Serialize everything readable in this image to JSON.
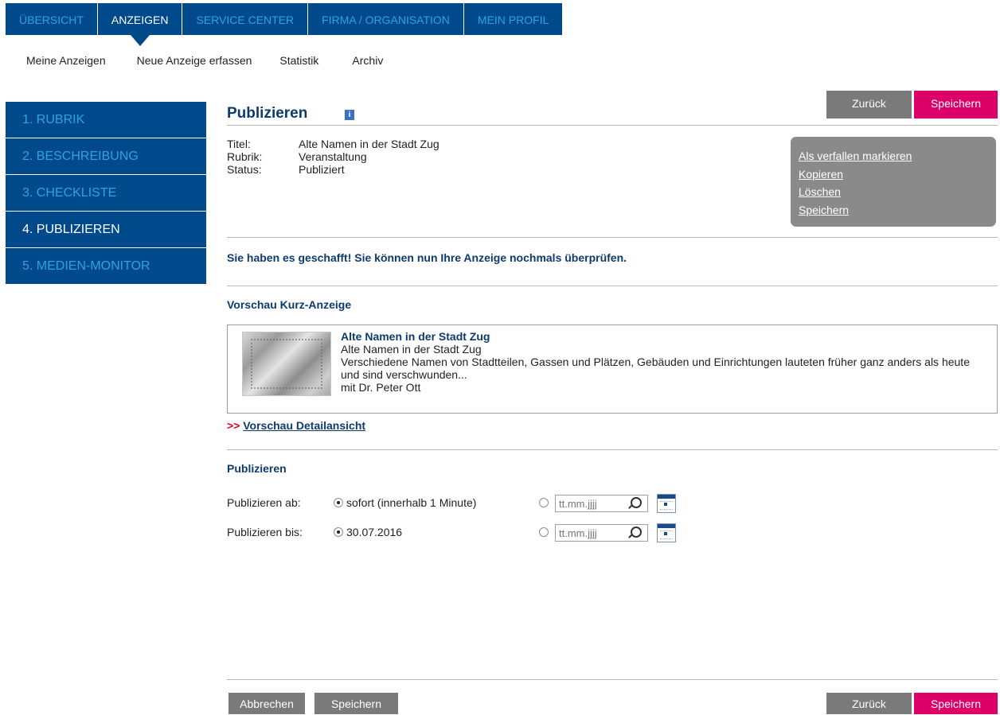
{
  "topnav": {
    "tabs": [
      {
        "label": "ÜBERSICHT"
      },
      {
        "label": "ANZEIGEN"
      },
      {
        "label": "SERVICE CENTER"
      },
      {
        "label": "FIRMA / ORGANISATION"
      },
      {
        "label": "MEIN PROFIL"
      }
    ]
  },
  "subnav": {
    "items": [
      {
        "label": "Meine Anzeigen"
      },
      {
        "label": "Neue Anzeige erfassen"
      },
      {
        "label": "Statistik"
      },
      {
        "label": "Archiv"
      }
    ]
  },
  "sidebar": {
    "steps": [
      {
        "label": "1. RUBRIK"
      },
      {
        "label": "2. BESCHREIBUNG"
      },
      {
        "label": "3. CHECKLISTE"
      },
      {
        "label": "4. PUBLIZIEREN"
      },
      {
        "label": "5. MEDIEN-MONITOR"
      }
    ]
  },
  "page": {
    "title": "Publizieren",
    "info_icon": "i",
    "back_label": "Zurück",
    "save_label": "Speichern"
  },
  "meta": {
    "titel_key": "Titel:",
    "titel_val": "Alte Namen in der Stadt Zug",
    "rubrik_key": "Rubrik:",
    "rubrik_val": "Veranstaltung",
    "status_key": "Status:",
    "status_val": "Publiziert"
  },
  "actions": {
    "expire": "Als verfallen markieren",
    "copy": "Kopieren",
    "delete": "Löschen",
    "save": "Speichern"
  },
  "success_message": "Sie haben es geschafft! Sie können nun Ihre Anzeige nochmals überprüfen.",
  "preview": {
    "heading": "Vorschau Kurz-Anzeige",
    "title": "Alte Namen in der Stadt Zug",
    "subtitle": "Alte Namen in der Stadt Zug",
    "description": "Verschiedene Namen von Stadtteilen, Gassen und Plätzen, Gebäuden und Einrichtungen lauteten früher ganz anders als heute und sind verschwunden...",
    "speaker": "mit Dr. Peter Ott",
    "detail_arrow": ">>",
    "detail_link": "Vorschau Detailansicht"
  },
  "publish": {
    "heading": "Publizieren",
    "from_label": "Publizieren ab:",
    "from_value": "sofort (innerhalb 1 Minute)",
    "to_label": "Publizieren bis:",
    "to_value": "30.07.2016",
    "date_placeholder": "tt.mm.jjjj"
  },
  "footer": {
    "cancel_label": "Abbrechen",
    "save_label": "Speichern",
    "back_label": "Zurück",
    "save2_label": "Speichern"
  },
  "colors": {
    "nav_blue": "#004a8b",
    "nav_inactive_text": "#2ea3de",
    "save_pink": "#de0069",
    "button_grey": "#7a7a7a"
  }
}
